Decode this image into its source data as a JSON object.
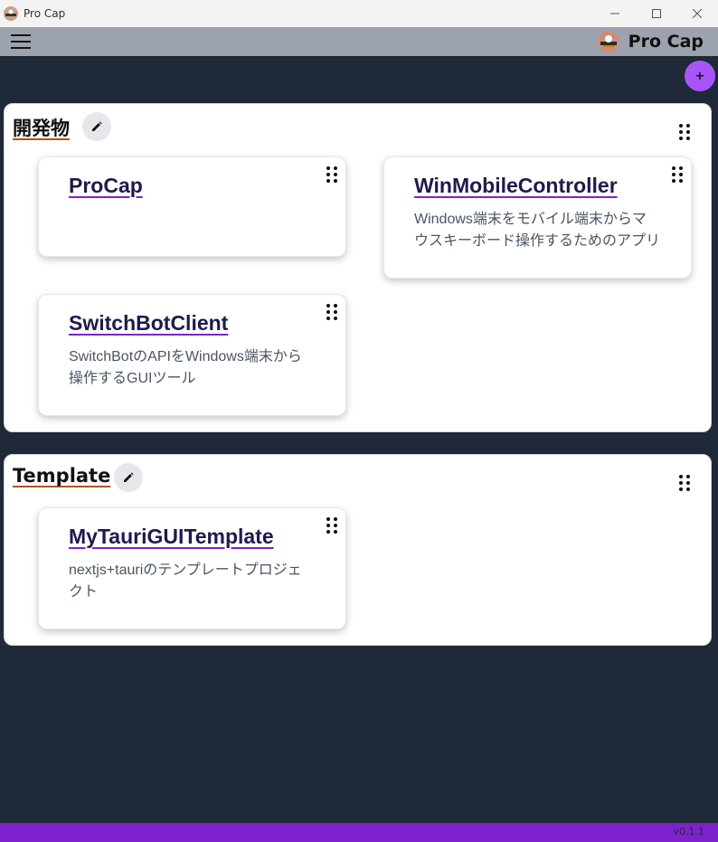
{
  "window": {
    "title": "Pro Cap",
    "minimize": "—",
    "maximize": "☐",
    "close": "✕"
  },
  "header": {
    "brand": "Pro Cap"
  },
  "add_button": {
    "label": "+"
  },
  "groups": [
    {
      "title": "開発物",
      "cards": [
        {
          "title": "ProCap",
          "description": ""
        },
        {
          "title": "WinMobileController",
          "description_lines": [
            "Windows端末をモバイル端末からマ",
            "ウスキーボード操作するためのアプリ"
          ]
        },
        {
          "title": "SwitchBotClient",
          "description_lines": [
            "SwitchBotのAPIをWindows端末から",
            "操作するGUIツール"
          ]
        }
      ]
    },
    {
      "title": "Template",
      "cards": [
        {
          "title": "MyTauriGUITemplate",
          "description_lines": [
            "nextjs+tauriのテンプレートプロジェ",
            "クト"
          ]
        }
      ]
    }
  ],
  "footer": {
    "version": "v0.1.1"
  }
}
